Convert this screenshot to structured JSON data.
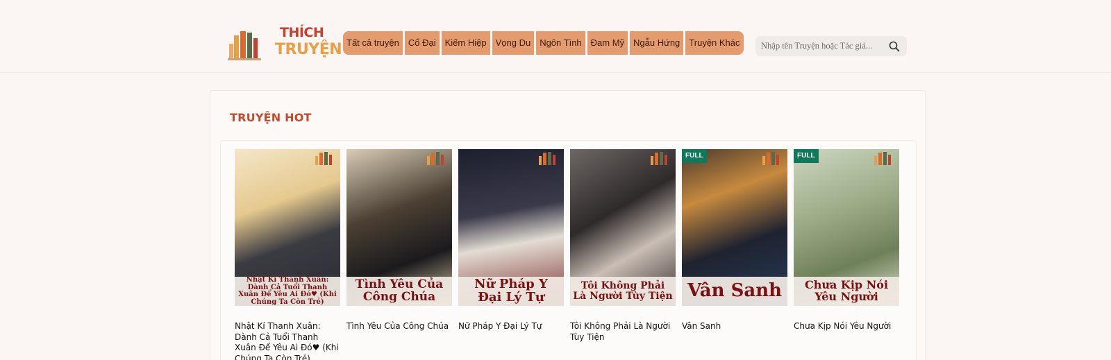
{
  "header": {
    "logo": {
      "line1": "THÍCH",
      "line2": "TRUYỆN"
    },
    "nav": [
      "Tất cả truyện",
      "Cổ Đại",
      "Kiếm Hiệp",
      "Vọng Du",
      "Ngôn Tình",
      "Đam Mỹ",
      "Ngẫu Hứng",
      "Truyện Khác"
    ],
    "search": {
      "placeholder": "Nhập tên Truyện hoặc Tác giả..."
    }
  },
  "hot": {
    "title": "TRUYỆN HOT",
    "items": [
      {
        "name": "Nhật Kí Thanh Xuân: Dành Cả Tuổi Thanh Xuân Để Yêu Ai Đó♥ (Khi Chúng Ta Còn Trẻ)",
        "cover_text": "Nhật Kí Thanh Xuân: Dành Cả Tuổi Thanh Xuân Để Yêu Ai Đó♥ (Khi Chúng Ta Còn Trẻ)",
        "badge": ""
      },
      {
        "name": "Tình Yêu Của Công Chúa",
        "cover_text": "Tình Yêu Của Công Chúa",
        "badge": ""
      },
      {
        "name": "Nữ Pháp Y Đại Lý Tự",
        "cover_text": "Nữ Pháp Y Đại Lý Tự",
        "badge": ""
      },
      {
        "name": "Tôi Không Phải Là Người Tùy Tiện",
        "cover_text": "Tôi Không Phải Là Người Tùy Tiện",
        "badge": ""
      },
      {
        "name": "Vân Sanh",
        "cover_text": "Vân Sanh",
        "badge": "FULL"
      },
      {
        "name": "Chưa Kịp Nói Yêu Người",
        "cover_text": "Chưa Kịp Nói Yêu Người",
        "badge": "FULL"
      }
    ]
  },
  "colors": {
    "background": "#fbf6f3",
    "nav_bg": "#e49b6d",
    "accent": "#c54a2c",
    "badge_full": "#0f7a5a"
  },
  "icons": {
    "search": "search-icon"
  }
}
